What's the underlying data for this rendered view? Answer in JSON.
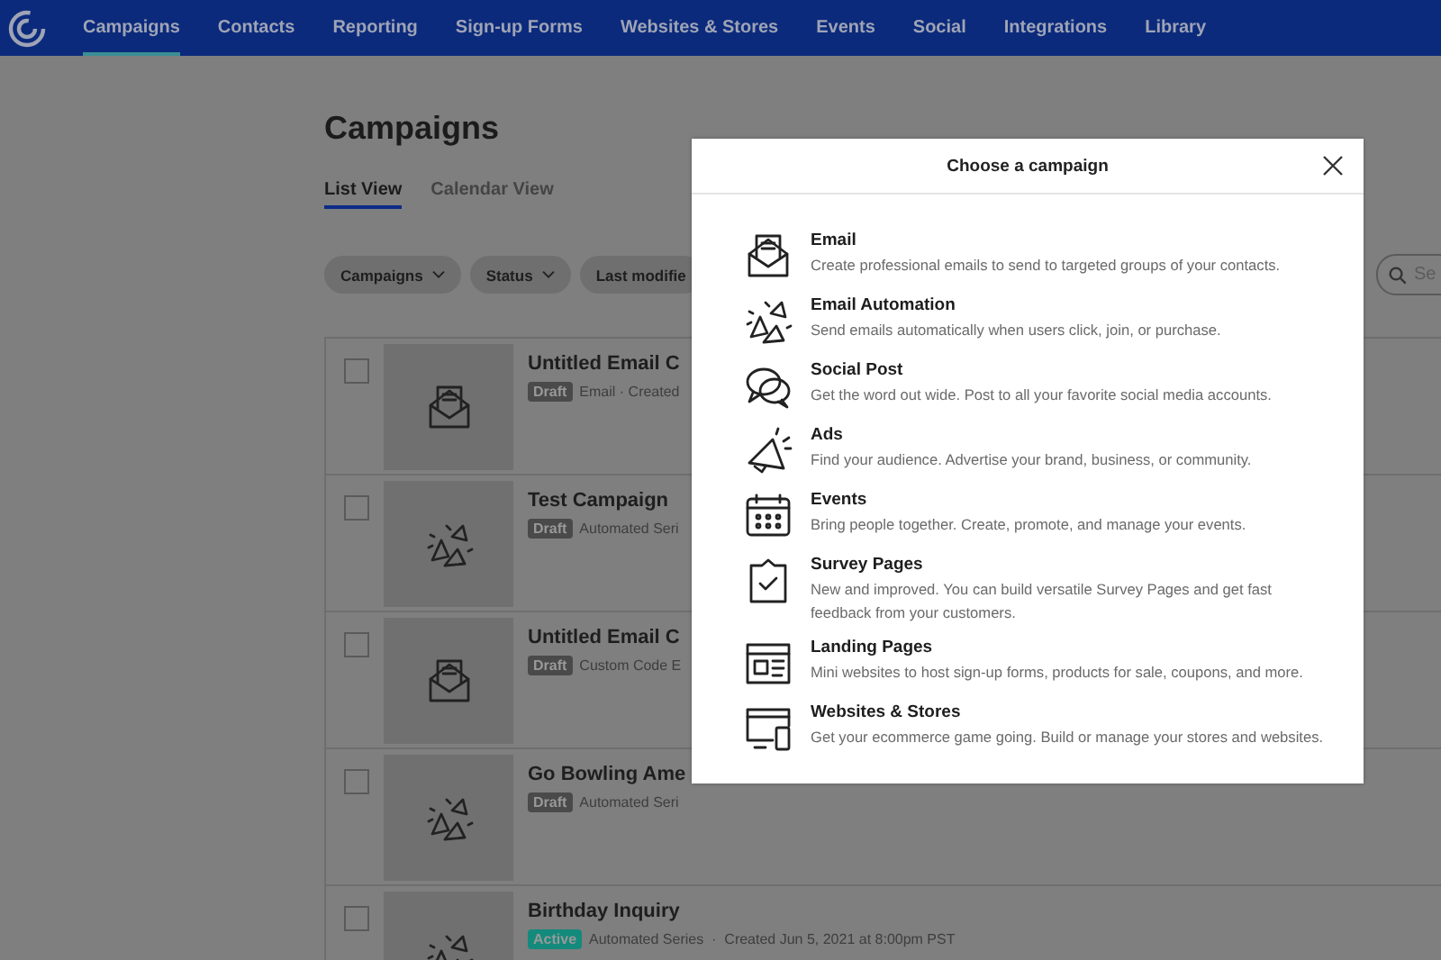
{
  "nav": {
    "items": [
      {
        "label": "Campaigns",
        "selected": true
      },
      {
        "label": "Contacts",
        "selected": false
      },
      {
        "label": "Reporting",
        "selected": false
      },
      {
        "label": "Sign-up Forms",
        "selected": false
      },
      {
        "label": "Websites & Stores",
        "selected": false
      },
      {
        "label": "Events",
        "selected": false
      },
      {
        "label": "Social",
        "selected": false
      },
      {
        "label": "Integrations",
        "selected": false
      },
      {
        "label": "Library",
        "selected": false
      }
    ]
  },
  "page": {
    "title": "Campaigns",
    "tabs": [
      {
        "label": "List View",
        "selected": true
      },
      {
        "label": "Calendar View",
        "selected": false
      }
    ],
    "filters": [
      {
        "label": "Campaigns",
        "dropdown": true
      },
      {
        "label": "Status",
        "dropdown": true
      },
      {
        "label": "Last modifie",
        "dropdown": false
      }
    ],
    "search": {
      "placeholder": "Se"
    },
    "rows": [
      {
        "kind": "email",
        "title": "Untitled Email C",
        "status": "Draft",
        "color": "#4a4a4a",
        "meta": "Email · Created",
        "checked": false
      },
      {
        "kind": "automation",
        "title": "Test Campaign",
        "status": "Draft",
        "color": "#4a4a4a",
        "meta": "Automated Seri",
        "checked": false
      },
      {
        "kind": "email",
        "title": "Untitled Email C",
        "status": "Draft",
        "color": "#4a4a4a",
        "meta": "Custom Code E",
        "checked": false
      },
      {
        "kind": "automation",
        "title": "Go Bowling Ame",
        "status": "Draft",
        "color": "#4a4a4a",
        "meta": "Automated Seri",
        "checked": false
      },
      {
        "kind": "automation",
        "title": "Birthday Inquiry",
        "status": "Active",
        "color": "#138a7c",
        "meta": "Automated Series  ·  Created Jun 5, 2021 at 8:00pm PST",
        "checked": false
      }
    ]
  },
  "dialog": {
    "title": "Choose a campaign",
    "options": [
      {
        "kind": "email",
        "title": "Email",
        "description": "Create professional emails to send to targeted groups of your contacts."
      },
      {
        "kind": "automation",
        "title": "Email Automation",
        "description": "Send emails automatically when users click, join, or purchase."
      },
      {
        "kind": "social",
        "title": "Social Post",
        "description": "Get the word out wide. Post to all your favorite social media accounts."
      },
      {
        "kind": "ads",
        "title": "Ads",
        "description": "Find your audience. Advertise your brand, business, or community."
      },
      {
        "kind": "events",
        "title": "Events",
        "description": "Bring people together. Create, promote, and manage your events."
      },
      {
        "kind": "survey",
        "title": "Survey Pages",
        "description": "New and improved. You can build versatile Survey Pages and get fast feedback from your customers."
      },
      {
        "kind": "landing",
        "title": "Landing Pages",
        "description": "Mini websites to host sign-up forms, products for sale, coupons, and more."
      },
      {
        "kind": "website",
        "title": "Websites & Stores",
        "description": "Get your ecommerce game going. Build or manage your stores and websites."
      }
    ]
  }
}
